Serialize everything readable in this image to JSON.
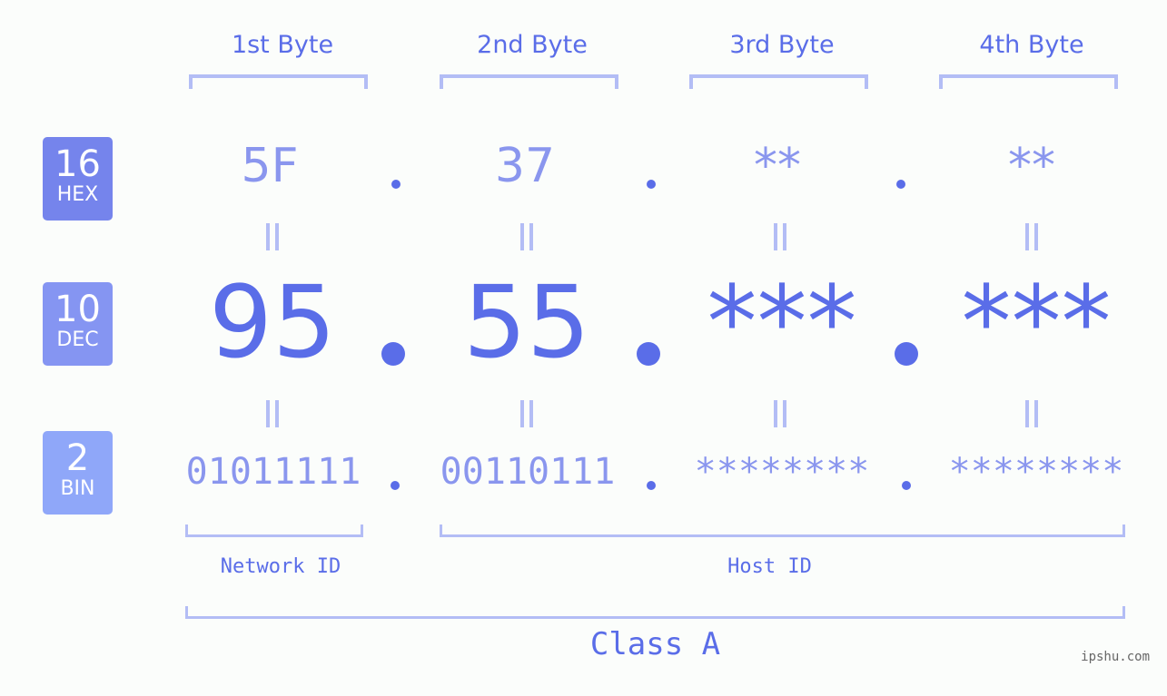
{
  "colors": {
    "accent": "#5a6de8",
    "light_accent": "#8a96ee",
    "bracket": "#b3bdf5",
    "hex_badge": "#7584ec",
    "dec_badge": "#8595f2",
    "bin_badge": "#8fa7f9",
    "background": "#fbfdfb"
  },
  "badges": [
    {
      "number": "16",
      "label": "HEX"
    },
    {
      "number": "10",
      "label": "DEC"
    },
    {
      "number": "2",
      "label": "BIN"
    }
  ],
  "byte_headers": [
    "1st Byte",
    "2nd Byte",
    "3rd Byte",
    "4th Byte"
  ],
  "hex": [
    "5F",
    "37",
    "**",
    "**"
  ],
  "dec": [
    "95",
    "55",
    "***",
    "***"
  ],
  "bin": [
    "01011111",
    "00110111",
    "********",
    "********"
  ],
  "sections": {
    "network_id": "Network ID",
    "host_id": "Host ID",
    "class": "Class A"
  },
  "watermark": "ipshu.com"
}
